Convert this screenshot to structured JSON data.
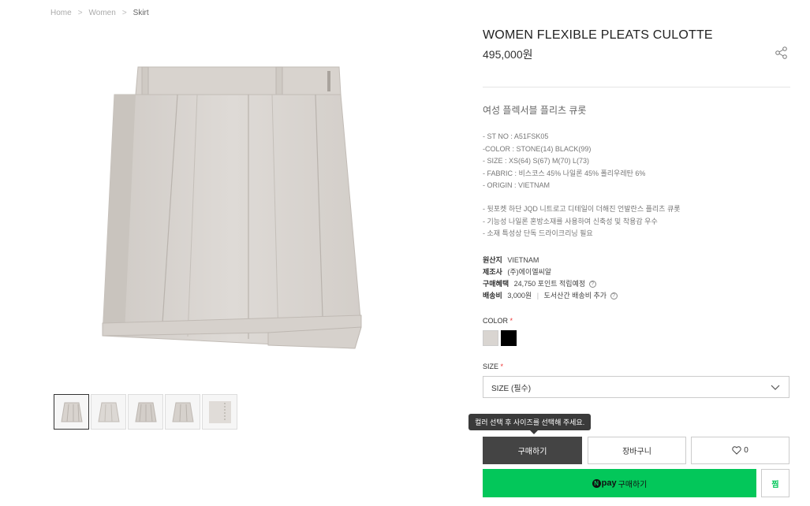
{
  "breadcrumb": {
    "home": "Home",
    "women": "Women",
    "current": "Skirt"
  },
  "product": {
    "title": "WOMEN FLEXIBLE PLEATS CULOTTE",
    "price": "495,000원",
    "subtitle": "여성 플렉서블 플리츠 큐롯",
    "specs": [
      "- ST NO : A51FSK05",
      "-COLOR : STONE(14) BLACK(99)",
      "- SIZE : XS(64) S(67) M(70) L(73)",
      "- FABRIC : 비스코스 45% 나일론 45% 폴리우레탄 6%",
      "- ORIGIN : VIETNAM"
    ],
    "description": [
      "-  뒷포켓 하단 JQD 니트로고 디테일이 더해진 언발란스 플리츠 큐롯",
      "- 기능성 나일론 혼방소재를 사용하여 신축성 및 착용감 우수",
      "- 소재 특성상 단독 드라이크리닝 필요"
    ],
    "meta": {
      "origin_key": "원산지",
      "origin_val": "VIETNAM",
      "maker_key": "제조사",
      "maker_val": "(주)에이엘씨알",
      "benefit_key": "구매혜택",
      "benefit_val": "24,750 포인트 적립예정",
      "shipping_key": "배송비",
      "shipping_val": "3,000원",
      "shipping_extra": "도서산간 배송비 추가"
    }
  },
  "options": {
    "color_label": "COLOR",
    "required_mark": "*",
    "colors": [
      {
        "name": "stone",
        "hex": "#d9d5d1"
      },
      {
        "name": "black",
        "hex": "#000000"
      }
    ],
    "size_label": "SIZE",
    "size_selected": "SIZE (필수)"
  },
  "tooltip": "컬러 선택 후 사이즈를 선택해 주세요.",
  "buttons": {
    "buy": "구매하기",
    "cart": "장바구니",
    "wish_count": "0",
    "npay_logo": "pay",
    "npay_n": "N",
    "npay_label": "구매하기",
    "zzim": "찜"
  },
  "colors": {
    "accent_green": "#03c75a",
    "buy_button": "#444444"
  }
}
